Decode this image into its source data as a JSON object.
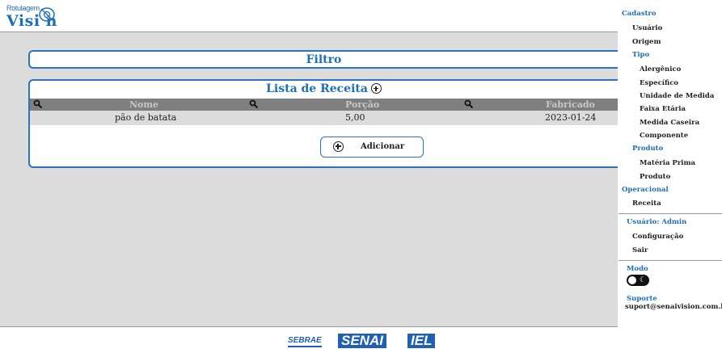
{
  "header": {
    "logo_top": "Rotulagem",
    "logo_main": "Visi n"
  },
  "filter": {
    "title": "Filtro"
  },
  "recipes": {
    "title": "Lista de Receita",
    "columns": [
      "Nome",
      "Porção",
      "Fabricado"
    ],
    "rows": [
      {
        "nome": "pão de batata",
        "porcao": "5,00",
        "fabricado": "2023-01-24"
      }
    ],
    "add_label": "Adicionar"
  },
  "footer": {
    "sebrae": "SEBRAE",
    "senai": "SENAI",
    "iel": "IEL"
  },
  "sidebar": {
    "cadastro": "Cadastro",
    "usuario": "Usuário",
    "origem": "Origem",
    "tipo": "Tipo",
    "alergenico": "Alergênico",
    "especifico": "Específico",
    "unidade_medida": "Unidade de Medida",
    "faixa_etaria": "Faixa Etária",
    "medida_caseira": "Medida Caseira",
    "componente": "Componente",
    "produto_sec": "Produto",
    "materia_prima": "Matéria Prima",
    "produto": "Produto",
    "operacional": "Operacional",
    "receita": "Receita",
    "user_label": "Usuário: Admin",
    "configuracao": "Configuração",
    "sair": "Sair",
    "modo": "Modo",
    "suporte": "Suporte",
    "suporte_email": "suport@senaivision.com.br"
  },
  "colors": {
    "accent": "#1d6fb8",
    "content_bg": "#dcdcdc",
    "table_header_bg": "#7f7f7f"
  },
  "icons": [
    "search-icon",
    "plus-circle-icon",
    "moon-icon"
  ]
}
